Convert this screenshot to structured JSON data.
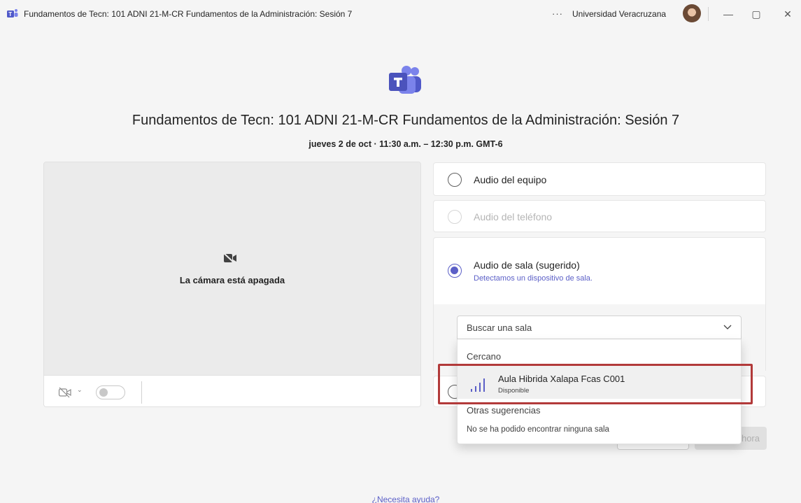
{
  "window": {
    "title": "Fundamentos de Tecn: 101 ADNI 21-M-CR Fundamentos de la Administración: Sesión 7",
    "more_label": "···",
    "org": "Universidad Veracruzana",
    "minimize": "—",
    "maximize": "▢",
    "close": "✕"
  },
  "meeting": {
    "title": "Fundamentos de Tecn: 101 ADNI 21-M-CR Fundamentos de la Administración: Sesión 7",
    "time": "jueves 2 de oct · 11:30 a.m. – 12:30 p.m. GMT-6"
  },
  "video": {
    "camera_off": "La cámara está apagada",
    "chevron": "⌄"
  },
  "audio": {
    "computer": "Audio del equipo",
    "phone": "Audio del teléfono",
    "room": "Audio de sala (sugerido)",
    "room_sub": "Detectamos un dispositivo de sala."
  },
  "room_search": {
    "placeholder": "Buscar una sala"
  },
  "dropdown": {
    "nearby_header": "Cercano",
    "items": [
      {
        "name": "Aula Hibrida Xalapa Fcas C001",
        "status": "Disponible"
      }
    ],
    "other_header": "Otras sugerencias",
    "empty": "No se ha podido encontrar ninguna sala"
  },
  "buttons": {
    "join_partial": "hora"
  },
  "help": "¿Necesita ayuda?",
  "colors": {
    "accent": "#5b5fc7",
    "highlight": "#b23a3a"
  }
}
